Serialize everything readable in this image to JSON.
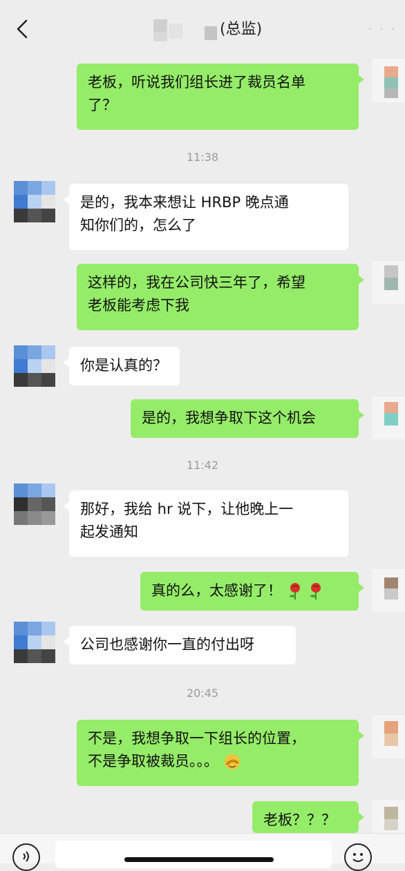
{
  "header": {
    "title": "(总监)",
    "back_icon": "chevron-left-icon",
    "more_icon": "more-dots-icon"
  },
  "colors": {
    "background": "#ededed",
    "my_bubble": "#95ec69",
    "other_bubble": "#ffffff",
    "timestamp": "#9a9a9a"
  },
  "timestamps": [
    "11:38",
    "11:42",
    "20:45"
  ],
  "messages": [
    {
      "from": "me",
      "lines": [
        "老板，听说我们组长进了裁员名单",
        "了？"
      ]
    },
    {
      "from": "other",
      "lines": [
        "是的，我本来想让 HRBP 晚点通",
        "知你们的，怎么了"
      ]
    },
    {
      "from": "me",
      "lines": [
        "这样的，我在公司快三年了，希望",
        "老板能考虑下我"
      ]
    },
    {
      "from": "other",
      "lines": [
        "你是认真的？"
      ]
    },
    {
      "from": "me",
      "lines": [
        "是的，我想争取下这个机会"
      ]
    },
    {
      "from": "other",
      "lines": [
        "那好，我给 hr 说下，让他晚上一",
        "起发通知"
      ]
    },
    {
      "from": "me",
      "lines": [
        "真的么，太感谢了！"
      ],
      "emoji": [
        "rose-emoji",
        "rose-emoji"
      ]
    },
    {
      "from": "other",
      "lines": [
        "公司也感谢你一直的付出呀"
      ]
    },
    {
      "from": "me",
      "lines": [
        "不是，我想争取一下组长的位置，",
        "不是争取被裁员。。。"
      ],
      "emoji": [
        "facepalm-emoji"
      ]
    },
    {
      "from": "me",
      "lines": [
        "老板？？？"
      ]
    }
  ],
  "bottom_bar": {
    "voice_icon": "voice-icon",
    "emoji_icon": "smile-icon"
  }
}
